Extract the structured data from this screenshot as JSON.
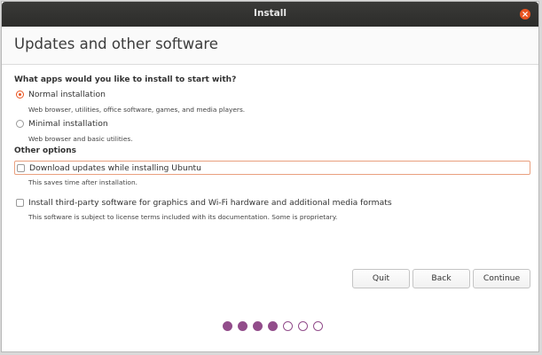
{
  "window": {
    "title": "Install"
  },
  "header": {
    "title": "Updates and other software"
  },
  "installation": {
    "question": "What apps would you like to install to start with?",
    "options": [
      {
        "label": "Normal installation",
        "description": "Web browser, utilities, office software, games, and media players.",
        "selected": true
      },
      {
        "label": "Minimal installation",
        "description": "Web browser and basic utilities.",
        "selected": false
      }
    ]
  },
  "other_options": {
    "heading": "Other options",
    "items": [
      {
        "label": "Download updates while installing Ubuntu",
        "description": "This saves time after installation.",
        "checked": false,
        "focused": true
      },
      {
        "label": "Install third-party software for graphics and Wi-Fi hardware and additional media formats",
        "description": "This software is subject to license terms included with its documentation. Some is proprietary.",
        "checked": false,
        "focused": false
      }
    ]
  },
  "buttons": {
    "quit": "Quit",
    "back": "Back",
    "continue": "Continue"
  },
  "progress": {
    "total_steps": 7,
    "completed_steps": 4
  },
  "colors": {
    "accent": "#e95420",
    "progress_dot": "#924d8b",
    "titlebar": "#2c2c2a"
  }
}
